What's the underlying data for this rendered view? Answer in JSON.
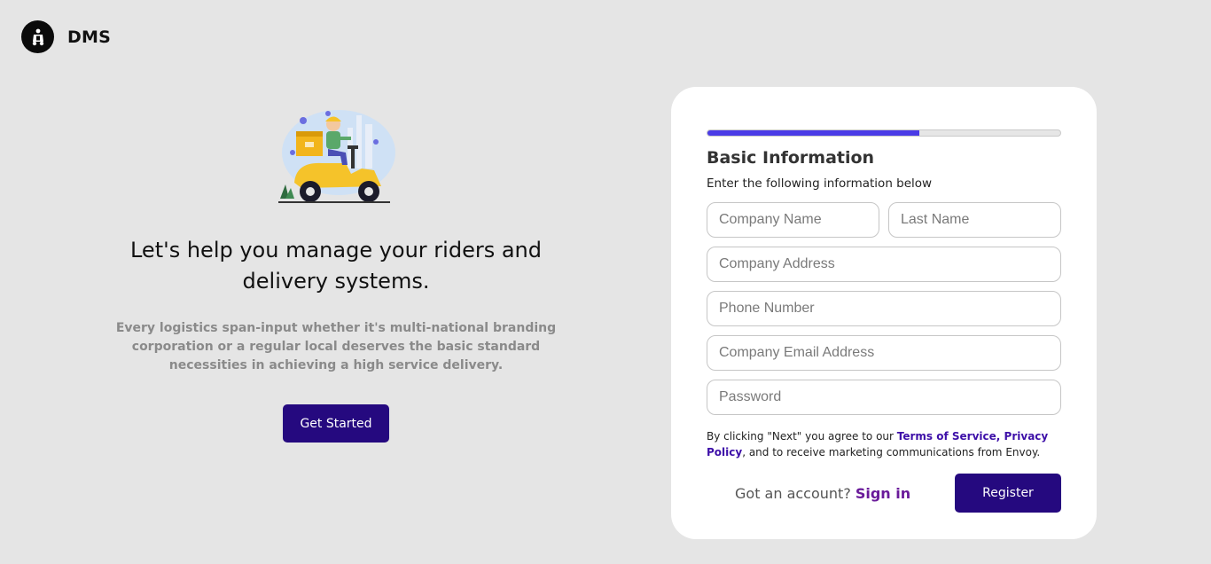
{
  "brand": {
    "name": "DMS",
    "logo_icon": "scooter-logo-icon"
  },
  "hero": {
    "illustration": "delivery-scooter-illustration",
    "title": "Let's help you manage your riders and delivery systems.",
    "description": "Every logistics span-input whether it's multi-national branding corporation or a regular local deserves the basic standard necessities in achieving a high service delivery.",
    "cta_label": "Get Started"
  },
  "form": {
    "progress": 0.6,
    "title": "Basic Information",
    "subtitle": "Enter the following information below",
    "fields": {
      "company_name": {
        "placeholder": "Company Name",
        "value": ""
      },
      "last_name": {
        "placeholder": "Last Name",
        "value": ""
      },
      "company_address": {
        "placeholder": "Company Address",
        "value": ""
      },
      "phone_number": {
        "placeholder": "Phone Number",
        "value": ""
      },
      "company_email": {
        "placeholder": "Company Email Address",
        "value": ""
      },
      "password": {
        "placeholder": "Password",
        "value": ""
      }
    },
    "terms": {
      "prefix": "By clicking \"Next\" you agree to our ",
      "terms_link": "Terms of Service",
      "separator": ", ",
      "privacy_link": "Privacy Policy",
      "suffix": ", and to receive marketing communications from Envoy."
    },
    "account_prompt": "Got an account?",
    "signin_label": "Sign in",
    "register_label": "Register"
  },
  "colors": {
    "background": "#e5e5e5",
    "primary_button": "#25097f",
    "progress_fill": "#4a3be6",
    "link": "#3d0fa8",
    "signin_link": "#6a1b9a"
  }
}
